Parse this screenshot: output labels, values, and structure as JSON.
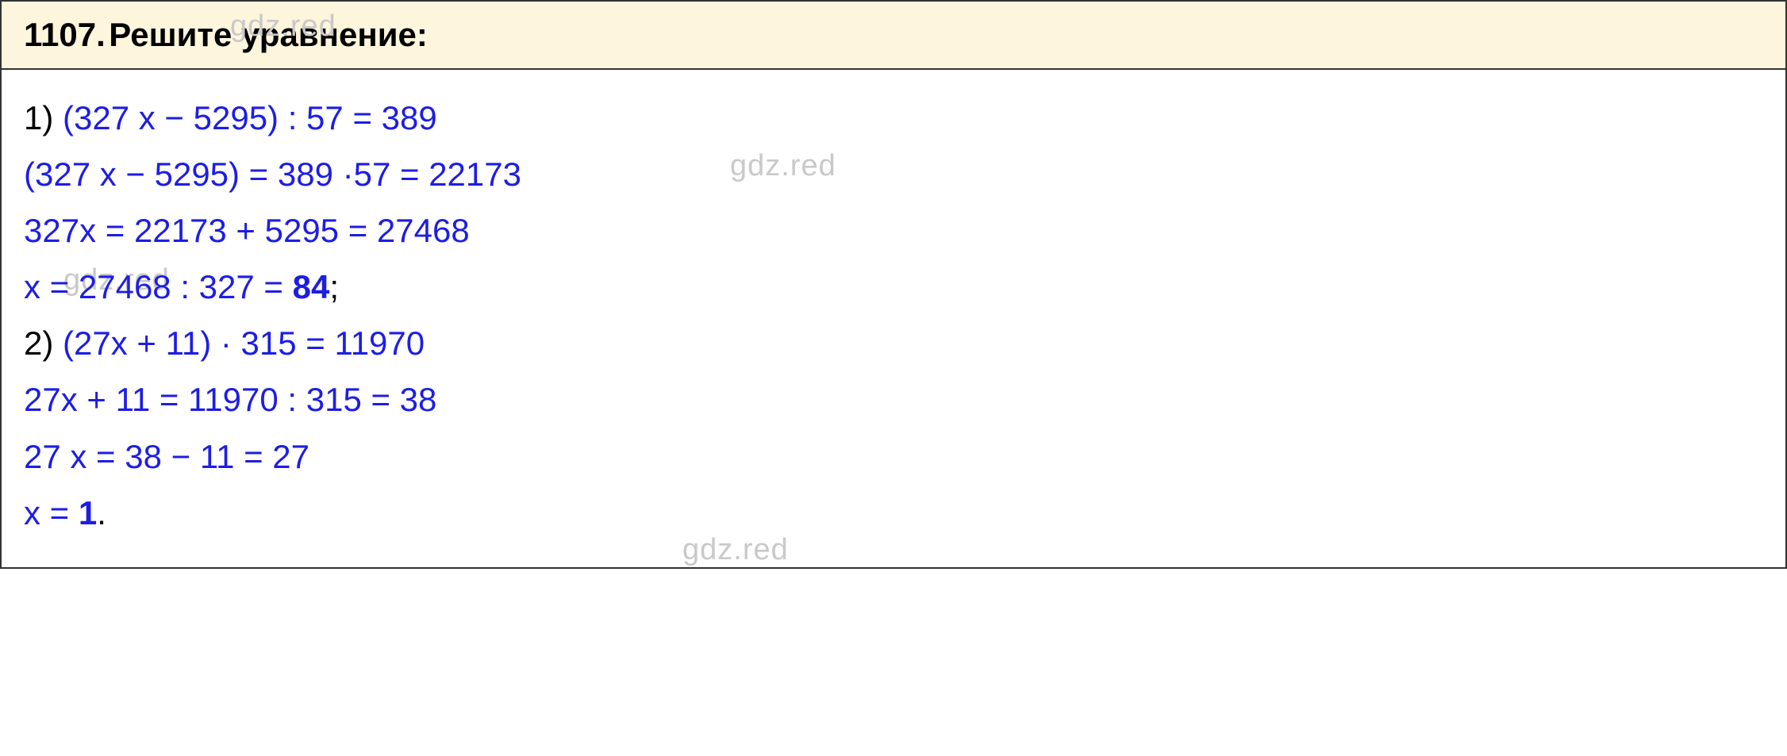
{
  "header": {
    "problem_number": "1107.",
    "title": "Решите уравнение:"
  },
  "solutions": [
    {
      "item_number": "1)",
      "equation": "(327 x − 5295) : 57 = 389",
      "steps": [
        "(327 x − 5295) = 389 ·57 = 22173",
        "327x = 22173 + 5295 = 27468",
        "x = 27468 : 327 = "
      ],
      "answer": "84",
      "trailing": ";"
    },
    {
      "item_number": "2)",
      "equation": "(27x + 11) · 315 = 11970",
      "steps": [
        "27x + 11 = 11970 : 315 = 38",
        "27 x = 38 − 11 = 27",
        "x = "
      ],
      "answer": "1",
      "trailing": "."
    }
  ],
  "watermark": "gdz.red"
}
